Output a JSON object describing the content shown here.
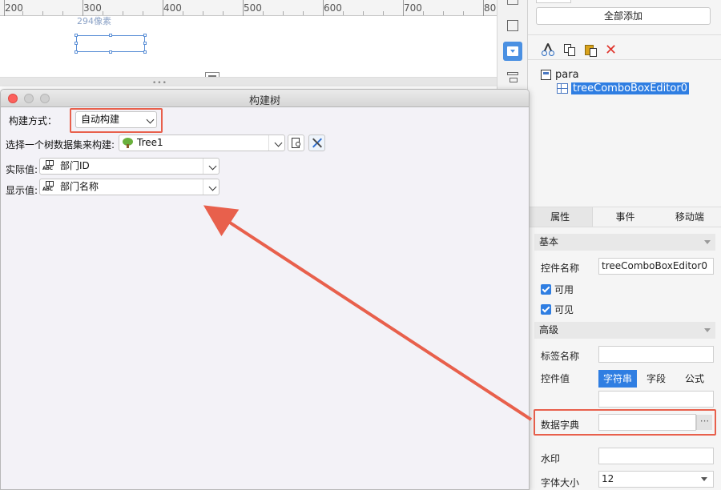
{
  "ruler": {
    "labels": [
      "200",
      "300",
      "400",
      "500",
      "600",
      "700",
      "80"
    ],
    "width_hint": "294像素"
  },
  "right_panel": {
    "add_all_button": "全部添加",
    "tree": {
      "root_label": "para",
      "child_label": "treeComboBoxEditor0"
    },
    "tabs": [
      "属性",
      "事件",
      "移动端"
    ],
    "sections": {
      "basic": "基本",
      "advanced": "高级"
    },
    "props": {
      "control_name_label": "控件名称",
      "control_name_value": "treeComboBoxEditor0",
      "enabled_label": "可用",
      "visible_label": "可见",
      "tag_name_label": "标签名称",
      "tag_name_value": "",
      "control_value_label": "控件值",
      "value_types": [
        "字符串",
        "字段",
        "公式"
      ],
      "control_value_value": "",
      "data_dict_label": "数据字典",
      "data_dict_value": "",
      "data_dict_more": "···",
      "watermark_label": "水印",
      "watermark_value": "",
      "font_size_label": "字体大小",
      "font_size_value": "12"
    }
  },
  "dialog": {
    "title": "构建树",
    "build_mode_label": "构建方式：",
    "build_mode_value": "自动构建",
    "dataset_label": "选择一个树数据集来构建:",
    "dataset_value": "Tree1",
    "actual_value_label": "实际值:",
    "actual_value_value": "部门ID",
    "display_value_label": "显示值:",
    "display_value_value": "部门名称"
  },
  "colors": {
    "accent_blue": "#2f7ee2",
    "annotation_red": "#e8604c",
    "close_button_red": "#fc605c"
  }
}
